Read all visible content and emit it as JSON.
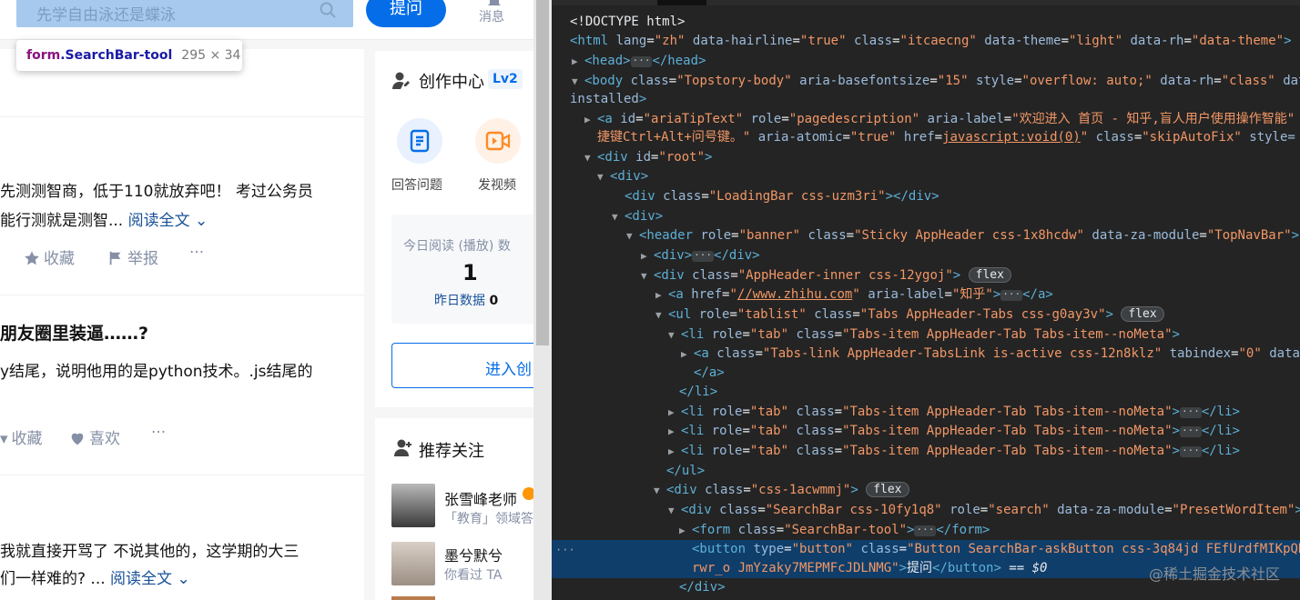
{
  "page": {
    "search": {
      "placeholder": "先学自由泳还是蝶泳"
    },
    "ask_label": "提问",
    "notifications_label": "消息",
    "tooltip": {
      "tag": "form",
      "class": ".SearchBar-tool",
      "dims": "295 × 34"
    },
    "feed": {
      "item1": {
        "line1": "先测测智商，低于110就放弃吧！ 考过公务员",
        "line2": "能行测就是测智... ",
        "more": "阅读全文 ⌄",
        "actions": [
          "收藏",
          "举报",
          "···"
        ]
      },
      "item2": {
        "title": "朋友圈里装逼……?",
        "line1": "y结尾，说明他用的是python技术。.js结尾的",
        "actions": [
          "收藏",
          "喜欢",
          "···"
        ]
      },
      "item3": {
        "line1": "我就直接开骂了 不说其他的，这学期的大三",
        "line2": "们一样难的? ... ",
        "more": "阅读全文 ⌄"
      }
    },
    "creator": {
      "title": "创作中心",
      "level": "Lv2",
      "answer_label": "回答问题",
      "video_label": "发视频",
      "today_label": "今日阅读 (播放) 数",
      "today_value": "1",
      "yesterday_label": "昨日数据",
      "yesterday_value": "0",
      "enter_label": "进入创"
    },
    "recommend": {
      "title": "推荐关注",
      "users": [
        {
          "name": "张雪峰老师",
          "desc": "「教育」领域答"
        },
        {
          "name": "墨兮默兮",
          "desc": "你看过 TA"
        }
      ]
    }
  },
  "devtools": {
    "watermark": "@稀土掘金技术社区",
    "selected_suffix": " == $0"
  }
}
